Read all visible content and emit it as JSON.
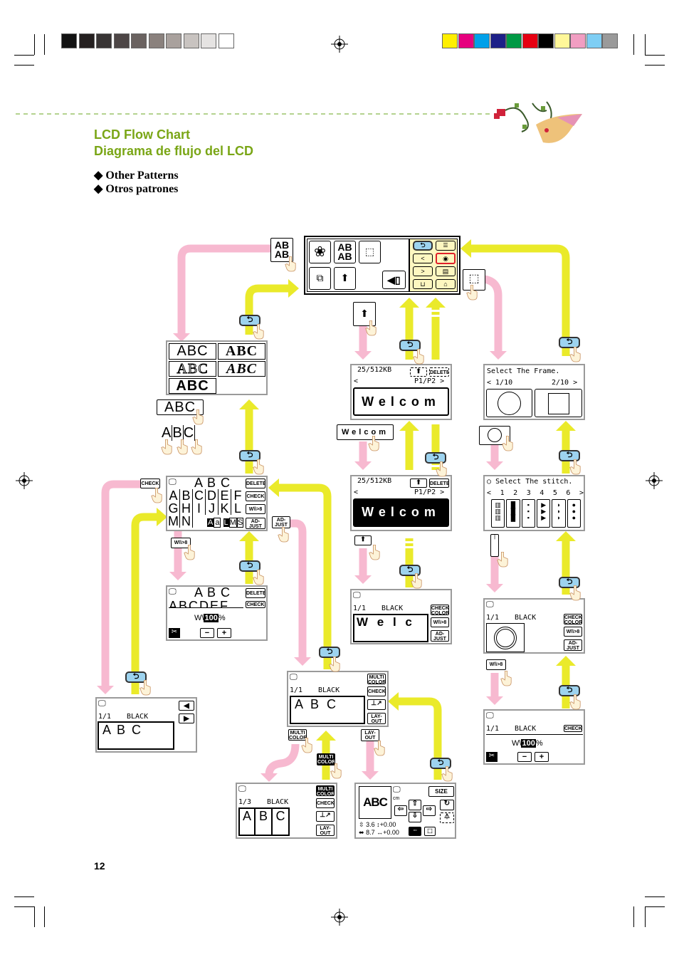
{
  "header": {
    "title_en": "LCD Flow Chart",
    "title_es": "Diagrama de flujo del LCD",
    "bullet_en": "Other Patterns",
    "bullet_es": "Otros patrones",
    "bullet_symbol": "◆",
    "page_number": "12"
  },
  "colors": {
    "title_green": "#7aa616",
    "pink_arrow": "#f7b9d0",
    "yellow_arrow": "#eaea2a",
    "back_button": "#9dd3ef",
    "panel_yellow": "#fdf7c0",
    "screen_border": "#9a9a9a"
  },
  "color_bars": {
    "gray": [
      "#000000",
      "#121212",
      "#252020",
      "#383434",
      "#4d4646",
      "#6a6260",
      "#8a817d",
      "#a9a19d",
      "#c8c3c0",
      "#e5e3e2",
      "#ffffff"
    ],
    "color": [
      "#ffef00",
      "#e6007e",
      "#00a0e9",
      "#1d2088",
      "#009944",
      "#e60012",
      "#000000",
      "#fff799",
      "#f19ec2",
      "#7ecef4",
      "#9a9a9a"
    ]
  },
  "buttons": {
    "delete": "DELETE",
    "check": "CHECK",
    "check_color": "CHECK COLOR",
    "adjust": "AD-JUST",
    "multi_color": "MULTI COLOR",
    "layout": "LAY-OUT",
    "size": "SIZE",
    "sewing_width": "W\\\\>8",
    "back": "⮌"
  },
  "top_panel": {
    "ab_top": "AB",
    "ab_bottom": "AB",
    "ab_key_top": "AB",
    "ab_key_bottom": "AB"
  },
  "font_panel": {
    "samples": [
      "ABC",
      "ABC",
      "ABC",
      "ABC",
      "ABC"
    ],
    "abc_key": "ABC",
    "tapped_letters": [
      "A",
      "B",
      "C"
    ]
  },
  "char_screen": {
    "preview": "A B C",
    "rows": [
      [
        "A",
        "B",
        "C",
        "D",
        "E",
        "F"
      ],
      [
        "G",
        "H",
        "I",
        "J",
        "K",
        "L"
      ],
      [
        "M",
        "N"
      ]
    ],
    "case_upper": "A",
    "case_lower": "a",
    "size_l": "L",
    "size_m": "M",
    "size_s": "S"
  },
  "size_screen": {
    "preview": "A B C",
    "row": [
      "A",
      "B",
      "C",
      "D",
      "E",
      "F"
    ],
    "zoom": "100",
    "unit": "%",
    "minus": "−",
    "plus": "+"
  },
  "memory_screen": {
    "capacity": "25/512KB",
    "prev": "<",
    "page": "P1/P2 >",
    "text": "Welcom",
    "tapped": "Welcom"
  },
  "memory_screen_selected": {
    "capacity": "25/512KB",
    "prev": "<",
    "page": "P1/P2 >",
    "text": "Welcom"
  },
  "frame_screen": {
    "prompt": "Select The Frame.",
    "page_left": "< 1/10",
    "page_right": "2/10 >"
  },
  "stitch_screen": {
    "prompt": "Select The stitch.",
    "prev": "<",
    "next": ">",
    "numbers": [
      "1",
      "2",
      "3",
      "4",
      "5",
      "6"
    ]
  },
  "edit_welcome": {
    "count": "1/1",
    "color": "BLACK",
    "text": "W e l c"
  },
  "edit_frame": {
    "count": "1/1",
    "color": "BLACK"
  },
  "frame_size": {
    "count": "1/1",
    "color": "BLACK",
    "zoom": "100",
    "unit": "%",
    "minus": "−",
    "plus": "+"
  },
  "edit_left": {
    "count": "1/1",
    "color": "BLACK",
    "text": "A B C",
    "left_arrow": "◀",
    "right_arrow": "▶"
  },
  "edit_center": {
    "count": "1/1",
    "color": "BLACK",
    "text": "A B C"
  },
  "multi_screen": {
    "count": "1/3",
    "color": "BLACK",
    "letters": [
      "A",
      "B",
      "C"
    ]
  },
  "layout_screen": {
    "preview": "ABC",
    "unit": "cm",
    "height": "3.6",
    "v_offset": "+0.00",
    "width": "8.7",
    "h_offset": "+0.00"
  }
}
